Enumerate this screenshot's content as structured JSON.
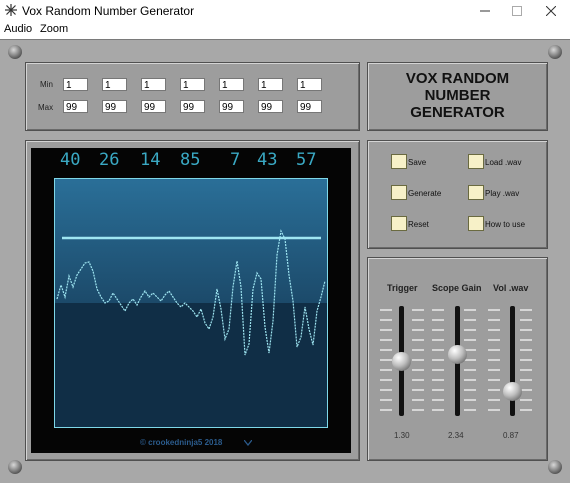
{
  "window": {
    "title": "Vox Random Number Generator"
  },
  "menu": {
    "audio": "Audio",
    "zoom": "Zoom"
  },
  "ranges": {
    "min_label": "Min",
    "max_label": "Max",
    "min_values": [
      "1",
      "1",
      "1",
      "1",
      "1",
      "1",
      "1"
    ],
    "max_values": [
      "99",
      "99",
      "99",
      "99",
      "99",
      "99",
      "99"
    ]
  },
  "brand": {
    "line1": "VOX RANDOM",
    "line2": "NUMBER",
    "line3": "GENERATOR"
  },
  "display": {
    "numbers": [
      "40",
      "26",
      "14",
      "85",
      "7",
      "43",
      "57"
    ],
    "copyright": "© crookedninja5 2018"
  },
  "buttons": {
    "save": "Save",
    "load_wav": "Load .wav",
    "generate": "Generate",
    "play_wav": "Play .wav",
    "reset": "Reset",
    "how_to_use": "How to use"
  },
  "sliders": [
    {
      "label": "Trigger",
      "value": "1.30"
    },
    {
      "label": "Scope Gain",
      "value": "2.34"
    },
    {
      "label": "Vol .wav",
      "value": "0.87"
    }
  ],
  "colors": {
    "panel": "#a8a8a8",
    "screen": "#050505",
    "digits": "#3aa9c4",
    "trace": "#7fd8e8"
  }
}
